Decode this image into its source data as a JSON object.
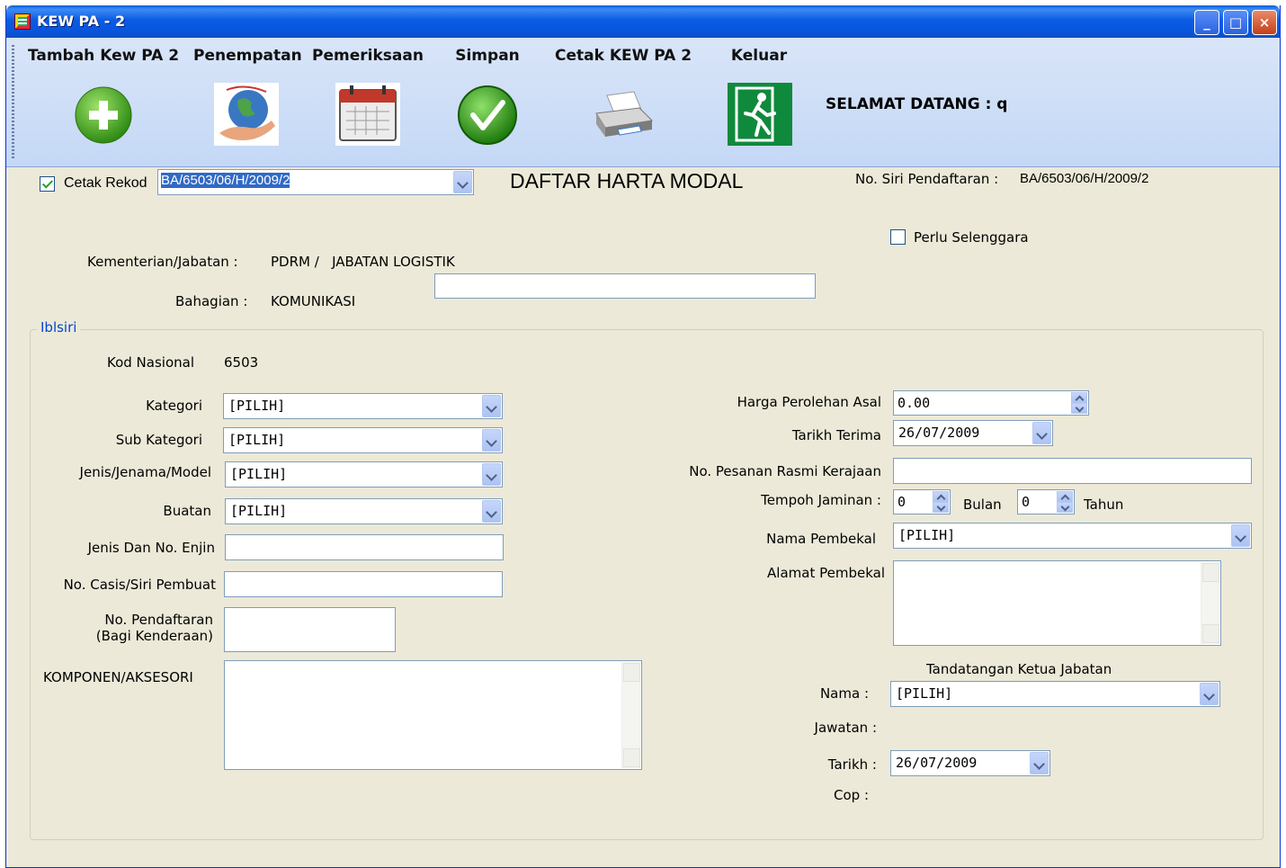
{
  "window": {
    "title": "KEW PA - 2",
    "minimize": "_",
    "maximize": "□",
    "close": "×"
  },
  "toolbar": {
    "tambah": "Tambah Kew PA 2",
    "penempatan": "Penempatan",
    "pemeriksaan": "Pemeriksaan",
    "simpan": "Simpan",
    "cetak": "Cetak KEW PA 2",
    "keluar": "Keluar",
    "welcome": "SELAMAT DATANG :  q"
  },
  "header": {
    "cetak_rekod_label": "Cetak Rekod",
    "cetak_rekod_value": "BA/6503/06/H/2009/2",
    "title": "DAFTAR HARTA MODAL",
    "no_siri_label": "No. Siri Pendaftaran :",
    "no_siri_value": "BA/6503/06/H/2009/2",
    "perlu_selenggara": "Perlu Selenggara",
    "kementerian_label": "Kementerian/Jabatan :",
    "kementerian_value": "PDRM /   JABATAN LOGISTIK",
    "bahagian_label": "Bahagian :",
    "bahagian_value": "KOMUNIKASI",
    "bahagian_input": ""
  },
  "group": {
    "title": "Iblsiri",
    "kod_nasional_label": "Kod Nasional",
    "kod_nasional_value": "6503",
    "kategori_label": "Kategori",
    "kategori_value": "[PILIH]",
    "sub_kategori_label": "Sub Kategori",
    "sub_kategori_value": "[PILIH]",
    "jenis_label": "Jenis/Jenama/Model",
    "jenis_value": "[PILIH]",
    "buatan_label": "Buatan",
    "buatan_value": "[PILIH]",
    "enjin_label": "Jenis Dan No. Enjin",
    "enjin_value": "",
    "casis_label": "No. Casis/Siri Pembuat",
    "casis_value": "",
    "pendaftaran_label_1": "No. Pendaftaran",
    "pendaftaran_label_2": "(Bagi Kenderaan)",
    "pendaftaran_value": "",
    "komponen_label": "KOMPONEN/AKSESORI",
    "komponen_value": "",
    "harga_label": "Harga Perolehan Asal",
    "harga_value": "0.00",
    "tarikh_terima_label": "Tarikh Terima",
    "tarikh_terima_value": "26/07/2009",
    "pesanan_label": "No. Pesanan Rasmi Kerajaan",
    "pesanan_value": "",
    "tempoh_label": "Tempoh Jaminan :",
    "bulan_value": "0",
    "bulan_label": "Bulan",
    "tahun_value": "0",
    "tahun_label": "Tahun",
    "pembekal_label": "Nama Pembekal",
    "pembekal_value": "[PILIH]",
    "alamat_label": "Alamat Pembekal",
    "alamat_value": "",
    "tandatangan_label": "Tandatangan Ketua Jabatan",
    "nama_label": "Nama :",
    "nama_value": "[PILIH]",
    "jawatan_label": "Jawatan :",
    "tarikh_label": "Tarikh :",
    "tarikh_value": "26/07/2009",
    "cop_label": "Cop :"
  },
  "colors": {
    "titlebar": "#0755dc",
    "toolbar": "#c4d8f6",
    "window": "#ece9d8",
    "group_title": "#0046d5"
  }
}
